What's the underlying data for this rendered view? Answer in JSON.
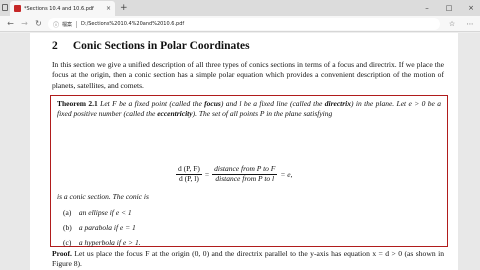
{
  "browser": {
    "tab_title": "*Sections 10.4 and 10.6.pdf",
    "tab_close": "×",
    "new_tab": "+",
    "window_controls": {
      "minimize": "–",
      "maximize": "□",
      "close": "×"
    },
    "address": {
      "info_icon": "ⓘ",
      "file_label": "檔案",
      "url": "D:/Sections%2010.4%20and%2010.6.pdf"
    },
    "nav": {
      "back": "←",
      "forward": "→",
      "refresh": "↻"
    },
    "right_icons": {
      "favorite": "☆",
      "more": "⋯"
    }
  },
  "document": {
    "section_number": "2",
    "section_title": "Conic Sections in Polar Coordinates",
    "intro": "In this section we give a unified description of all three types of conics sections in terms of a focus and directrix. If we place the focus at the origin, then a conic section has a simple polar equation which provides a convenient description of the motion of planets, satellites, and comets.",
    "theorem": {
      "label": "Theorem 2.1",
      "text_1": " Let F be a fixed point (called the ",
      "term_focus": "focus",
      "text_2": ") and l be a fixed line (called the ",
      "term_directrix": "directrix",
      "text_3": ") in the plane. Let e > 0 be a fixed positive number (called the ",
      "term_eccentricity": "eccentricity",
      "text_4": "). The set of all points P in the plane satisfying",
      "formula": {
        "lhs_num": "d (P, F)",
        "lhs_den": "d (P, l)",
        "eq1": "=",
        "rhs_num": "distance from P to F",
        "rhs_den": "distance from P to l",
        "eq2": "= e,"
      },
      "conic_line": "is a conic section.  The conic is",
      "cases": [
        {
          "tag": "(a)",
          "text": "an ellipse if e < 1"
        },
        {
          "tag": "(b)",
          "text": "a parabola if e = 1"
        },
        {
          "tag": "(c)",
          "text": "a hyperbola if e > 1."
        }
      ]
    },
    "proof": {
      "label": "Proof.",
      "text": " Let us place the focus F at the origin (0, 0) and the directrix parallel to the y-axis has equation x = d > 0 (as shown in Figure 8)."
    }
  },
  "colors": {
    "theorem_border": "#b01c1c",
    "page_bg": "#ffffff",
    "viewer_bg": "#e8e8e8"
  }
}
